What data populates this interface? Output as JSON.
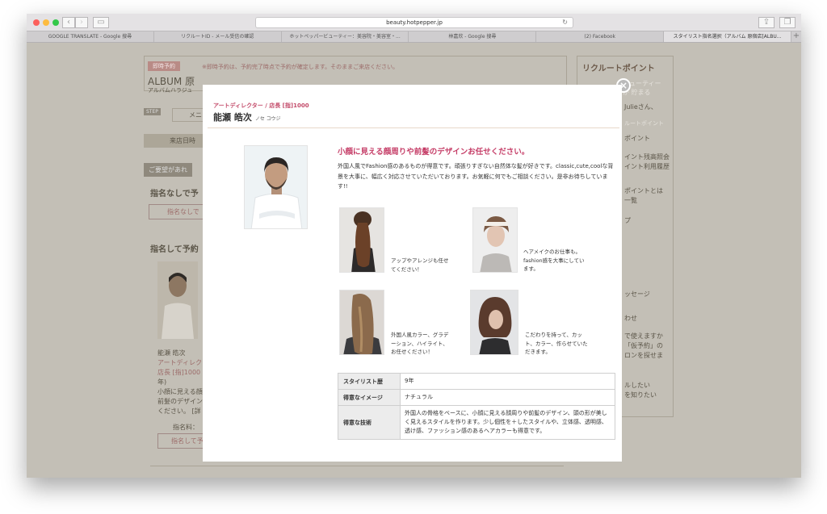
{
  "browser": {
    "url": "beauty.hotpepper.jp",
    "tabs": [
      "GOOGLE TRANSLATE - Google 搜尋",
      "リクルートID - メール受信の確認",
      "ホットペッパービューティー：美容院・美容室・...",
      "林嘉欣 - Google 搜尋",
      "(2) Facebook",
      "スタイリスト指名選択（アルバム 原宿店[ALBU..."
    ]
  },
  "background": {
    "badge": "即時予約",
    "notice": "※即時予約は、予約完了時点で予約が確定します。そのままご来店ください。",
    "salon_name": "ALBUM 原",
    "salon_kana": "アルバムハラジュ",
    "step": "STEP",
    "menu_btn": "メニ",
    "visit_tab": "来店日時",
    "request_bar": "ご要望があれ",
    "no_nomination_heading": "指名なしで予",
    "no_nomination_btn": "指名なしで",
    "nomination_heading": "指名して予約",
    "stylist_name": "能瀬 皓次",
    "stylist_role_lines": [
      "アートディレク",
      "店長 [指]1000",
      "年)"
    ],
    "stylist_desc_lines": [
      "小顔に見える顔",
      "前髪のデザイン",
      "ください。 [詳"
    ],
    "fee": "指名料：",
    "nominate_btn": "指名して予",
    "side_brand": "リクルートポイント",
    "side_lines": [
      "ビューティー",
      "が 貯まる",
      "Julieさん、",
      "ルートポイント",
      "ポイント",
      "イント残高照会",
      "イント利用履歴",
      "ポイントとは",
      "一覧",
      "プ",
      "ッセージ",
      "わせ",
      "で使えますか",
      "「仮予約」の",
      "ロンを探せま",
      "ルしたい",
      "を知りたい"
    ]
  },
  "modal": {
    "role": "アートディレクター / 店長 [指]1000",
    "name": "能瀬 皓次",
    "kana": "ノセ コウジ",
    "close": "×",
    "headline": "小顔に見える顔周りや前髪のデザインお任せください。",
    "description": "外国人風でFashion感のあるものが得意です。頑張りすぎない自然体な髪が好きです。classic,cute,coolな背景を大事に、幅広く対応させていただいております。お気軽に何でもご相談ください。是非お待ちしています!!",
    "styles": [
      {
        "caption": "アップやアレンジも任せてください！"
      },
      {
        "caption": "ヘアメイクのお仕事も。fashion感を大事にしています。"
      },
      {
        "caption": "外国人風カラー、グラデーション、ハイライト、お任せください！"
      },
      {
        "caption": "こだわりを持って、カット、カラー、作らせていただきます。"
      }
    ],
    "table": [
      {
        "label": "スタイリスト歴",
        "value": "9年"
      },
      {
        "label": "得意なイメージ",
        "value": "ナチュラル"
      },
      {
        "label": "得意な技術",
        "value": "外国人の骨格をベースに、小顔に見える顔周りや前髪のデザイン、頭の形が美しく見えるスタイルを作ります。少し個性を＋したスタイルや、立体感、透明感、透け感、ファッション感のあるヘアカラーも得意です。"
      }
    ]
  }
}
